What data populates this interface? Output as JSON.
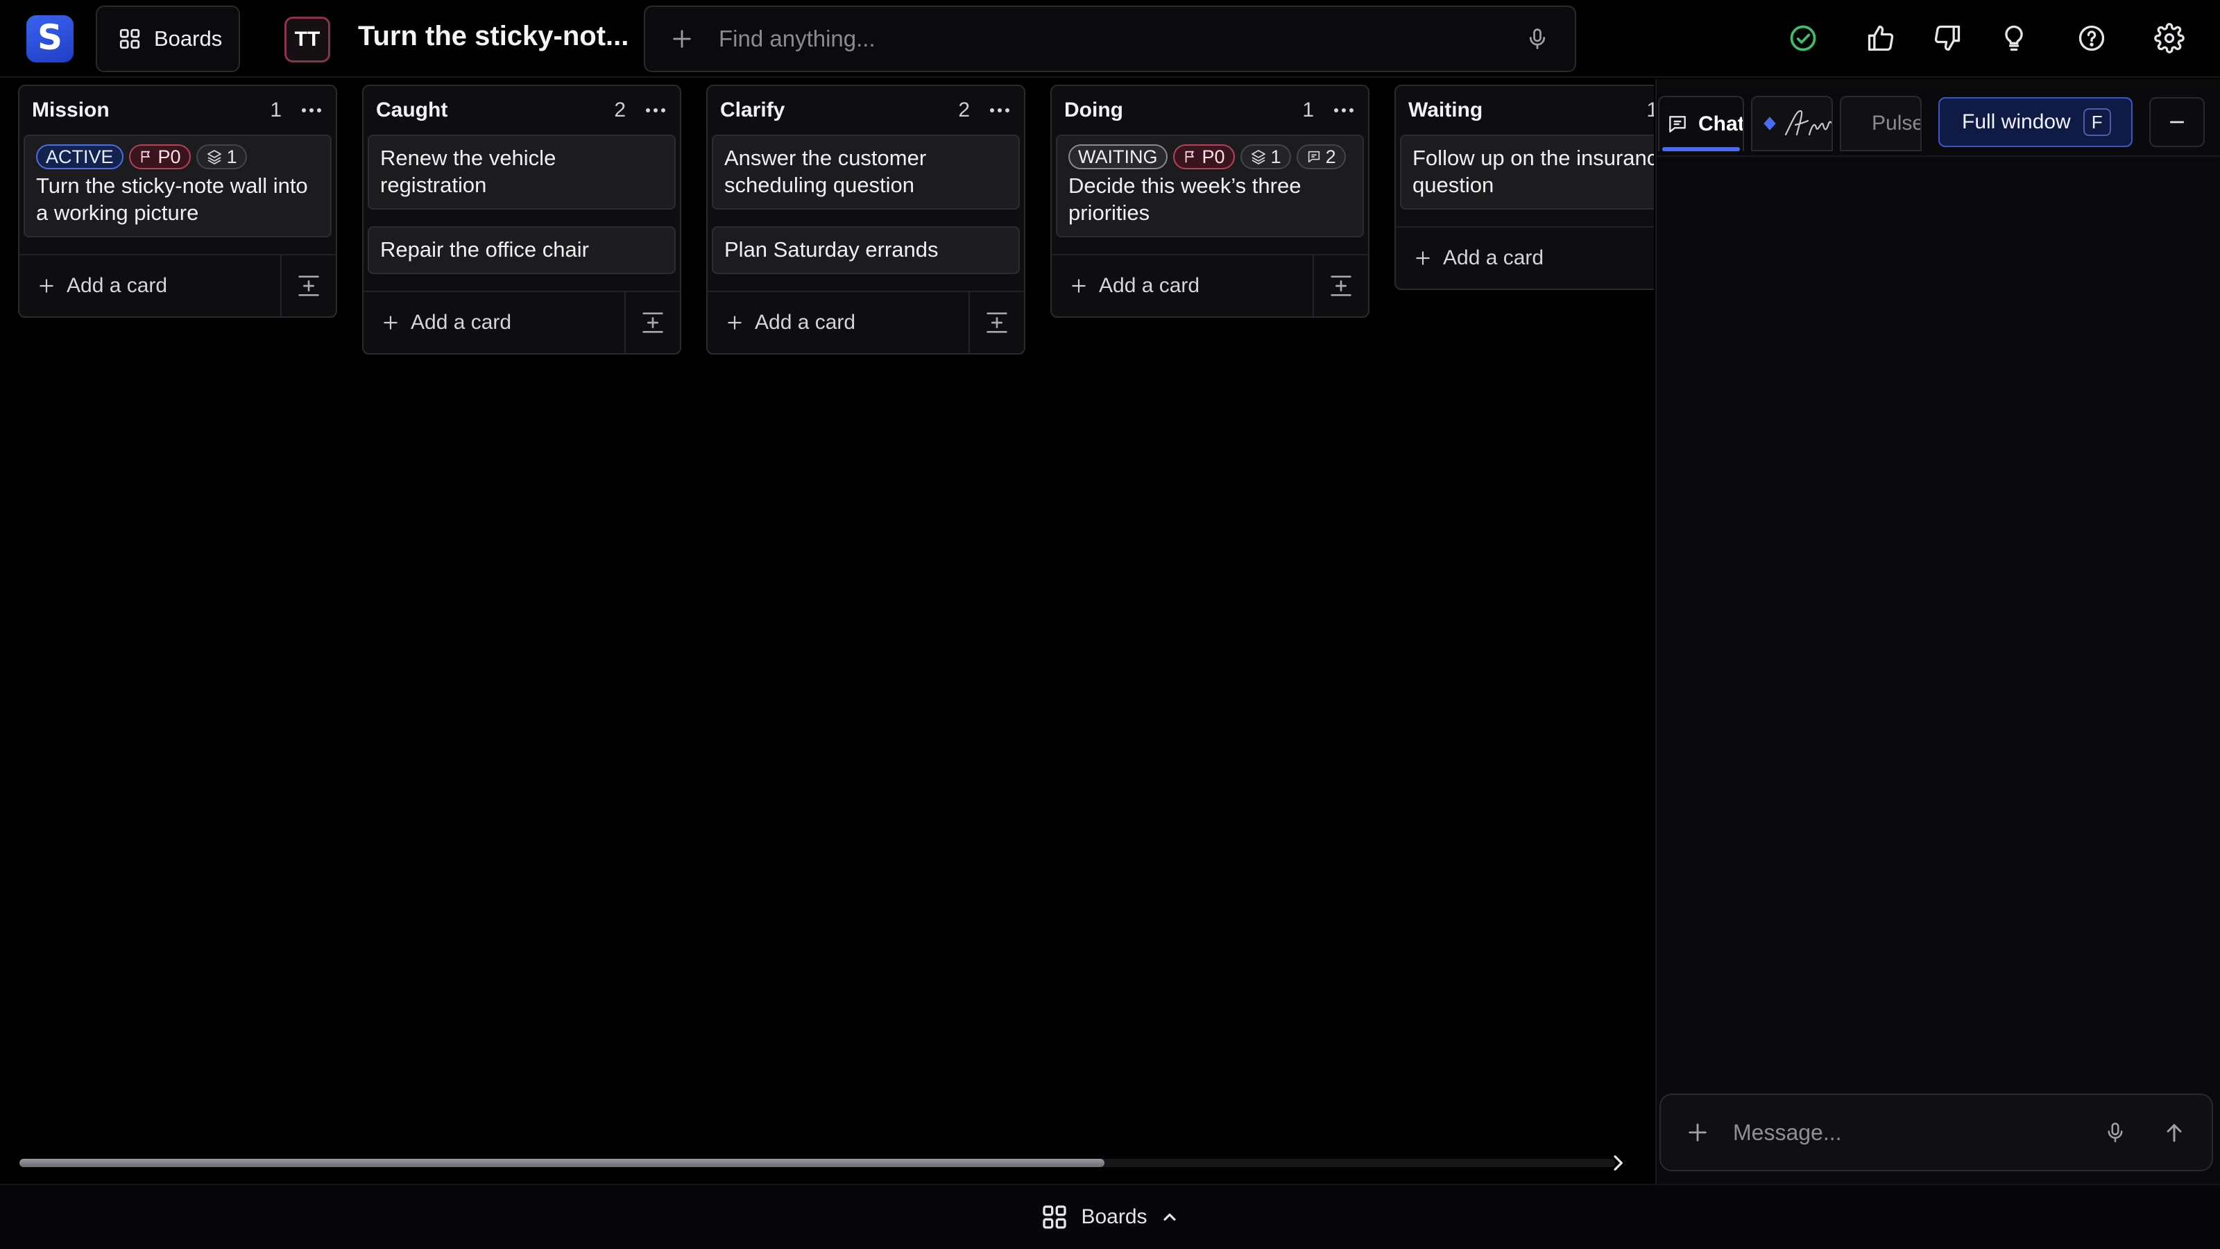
{
  "app": {
    "logo_letter": "S",
    "board_title": "Turn the sticky-not...",
    "avatar_initials": "TT",
    "boards_button_label": "Boards"
  },
  "search": {
    "placeholder": "Find anything..."
  },
  "toolbar_icons": [
    "check-circle-icon",
    "thumbs-up-icon",
    "thumbs-down-icon",
    "lightbulb-icon",
    "help-icon",
    "gear-icon"
  ],
  "add_card_label": "Add a card",
  "columns": [
    {
      "name": "Mission",
      "count": "1",
      "cards": [
        {
          "status": "ACTIVE",
          "priority": "P0",
          "subtasks": "1",
          "title": "Turn the sticky-note wall into a working picture"
        }
      ]
    },
    {
      "name": "Caught",
      "count": "2",
      "cards": [
        {
          "title": "Renew the vehicle registration"
        },
        {
          "title": "Repair the office chair"
        }
      ]
    },
    {
      "name": "Clarify",
      "count": "2",
      "cards": [
        {
          "title": "Answer the customer scheduling question"
        },
        {
          "title": "Plan Saturday errands"
        }
      ]
    },
    {
      "name": "Doing",
      "count": "1",
      "cards": [
        {
          "status": "WAITING",
          "priority": "P0",
          "subtasks": "1",
          "comments": "2",
          "title": "Decide this week’s three priorities"
        }
      ]
    },
    {
      "name": "Waiting",
      "count": "1",
      "cards": [
        {
          "title": "Follow up on the insurance question"
        }
      ]
    }
  ],
  "scroll": {
    "horizontal_position_fraction": 0.68
  },
  "chat_panel": {
    "tabs": [
      {
        "label": "Chat",
        "active": true
      },
      {
        "label": "",
        "icon": "diamond-icon",
        "active": false
      },
      {
        "label": "Pulse",
        "active": false
      }
    ],
    "full_window_label": "Full window",
    "full_window_key": "F",
    "composer_placeholder": "Message..."
  },
  "bottom_bar": {
    "label": "Boards"
  },
  "colors": {
    "accent": "#4b6cf0",
    "active_badge": "#4c6ee0",
    "priority_badge": "#b54357",
    "success": "#3fbf6a"
  }
}
